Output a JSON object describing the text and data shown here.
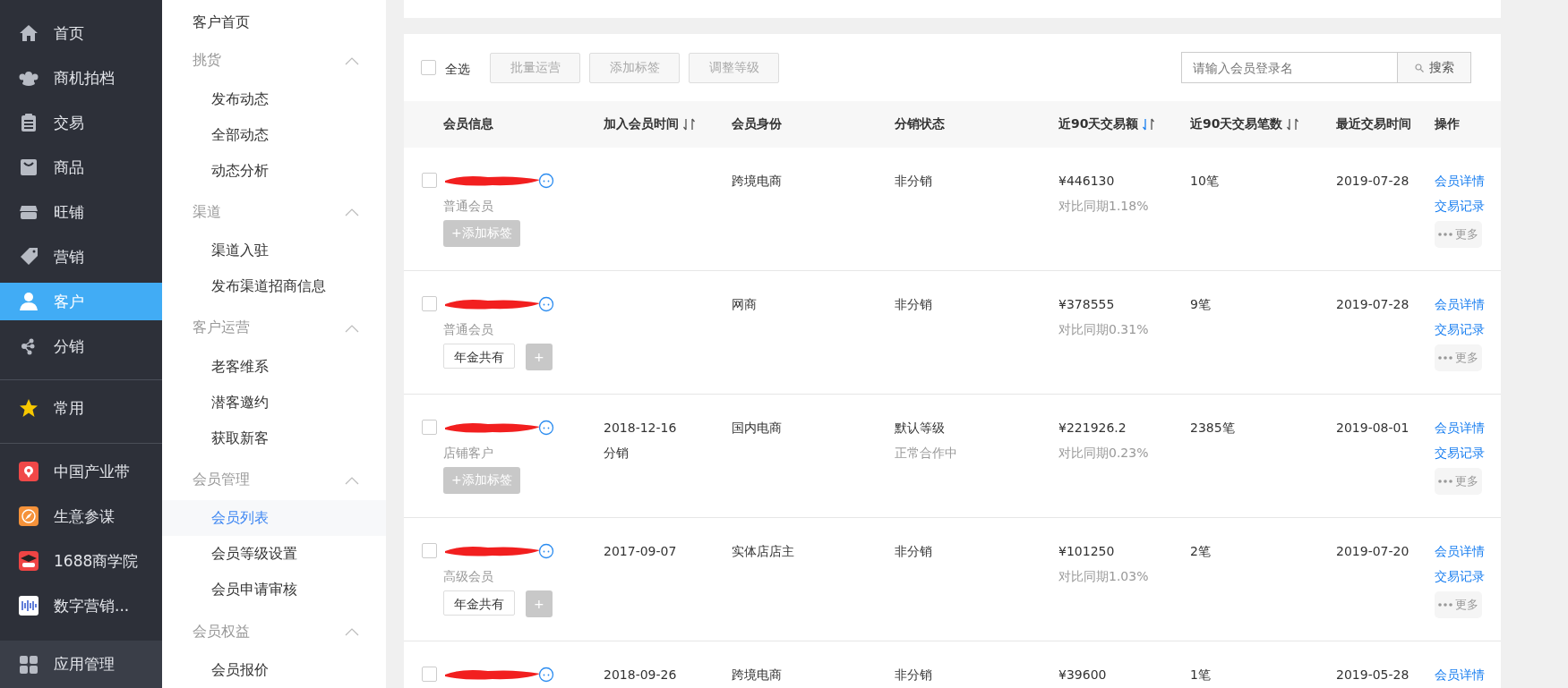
{
  "sidebar": {
    "groups": [
      [
        {
          "label": "首页",
          "selected": false
        },
        {
          "label": "商机拍档",
          "selected": false
        },
        {
          "label": "交易",
          "selected": false
        },
        {
          "label": "商品",
          "selected": false
        },
        {
          "label": "旺铺",
          "selected": false
        },
        {
          "label": "营销",
          "selected": false
        },
        {
          "label": "客户",
          "selected": true
        },
        {
          "label": "分销",
          "selected": false
        }
      ],
      [
        {
          "label": "常用",
          "selected": false
        }
      ],
      [
        {
          "label": "中国产业带",
          "selected": false
        },
        {
          "label": "生意参谋",
          "selected": false
        },
        {
          "label": "1688商学院",
          "selected": false
        },
        {
          "label": "数字营销...",
          "selected": false
        }
      ]
    ],
    "footer": {
      "label": "应用管理"
    }
  },
  "submenu": {
    "home": "客户首页",
    "sections": [
      {
        "title": "挑货",
        "expanded": true,
        "items": [
          {
            "label": "发布动态",
            "selected": false
          },
          {
            "label": "全部动态",
            "selected": false
          },
          {
            "label": "动态分析",
            "selected": false
          }
        ]
      },
      {
        "title": "渠道",
        "expanded": true,
        "items": [
          {
            "label": "渠道入驻",
            "selected": false
          },
          {
            "label": "发布渠道招商信息",
            "selected": false
          }
        ]
      },
      {
        "title": "客户运营",
        "expanded": true,
        "items": [
          {
            "label": "老客维系",
            "selected": false
          },
          {
            "label": "潜客邀约",
            "selected": false
          },
          {
            "label": "获取新客",
            "selected": false
          }
        ]
      },
      {
        "title": "会员管理",
        "expanded": true,
        "items": [
          {
            "label": "会员列表",
            "selected": true
          },
          {
            "label": "会员等级设置",
            "selected": false
          },
          {
            "label": "会员申请审核",
            "selected": false
          }
        ]
      },
      {
        "title": "会员权益",
        "expanded": true,
        "items": [
          {
            "label": "会员报价",
            "selected": false
          }
        ]
      }
    ]
  },
  "toolbar": {
    "select_all": {
      "label": "全选",
      "checked": false
    },
    "buttons": [
      {
        "label": "批量运营",
        "disabled": true
      },
      {
        "label": "添加标签",
        "disabled": true
      },
      {
        "label": "调整等级",
        "disabled": true
      }
    ],
    "search": {
      "placeholder": "请输入会员登录名",
      "button": "搜索"
    }
  },
  "table": {
    "columns": [
      {
        "label": "会员信息"
      },
      {
        "label": "加入会员时间",
        "sorted": false
      },
      {
        "label": "会员身份"
      },
      {
        "label": "分销状态"
      },
      {
        "label": "近90天交易额",
        "sorted": true
      },
      {
        "label": "近90天交易笔数",
        "sorted": false
      },
      {
        "label": "最近交易时间"
      },
      {
        "label": "操作"
      }
    ],
    "rows": [
      {
        "checked": false,
        "level": "普通会员",
        "tags": [],
        "add_tag": "+添加标签",
        "identity": "跨境电商",
        "distribution": "非分销",
        "amount": "¥446130",
        "compare": "对比同期1.18%",
        "count": "10笔",
        "last_trade": "2019-07-28",
        "actions": [
          {
            "kind": "link",
            "label": "会员详情"
          },
          {
            "kind": "link",
            "label": "交易记录"
          },
          {
            "kind": "more",
            "label": "更多"
          }
        ]
      },
      {
        "checked": false,
        "level": "普通会员",
        "tags": [
          "年金共有"
        ],
        "add_tag": "+",
        "identity": "网商",
        "distribution": "非分销",
        "amount": "¥378555",
        "compare": "对比同期0.31%",
        "count": "9笔",
        "last_trade": "2019-07-28",
        "actions": [
          {
            "kind": "link",
            "label": "会员详情"
          },
          {
            "kind": "link",
            "label": "交易记录"
          },
          {
            "kind": "more",
            "label": "更多"
          }
        ]
      },
      {
        "checked": false,
        "level": "店铺客户",
        "tags": [],
        "add_tag": "+添加标签",
        "join_date": "2018-12-16",
        "join_note": "分销",
        "identity": "国内电商",
        "distribution": "默认等级",
        "distribution_note": "正常合作中",
        "amount": "¥221926.2",
        "compare": "对比同期0.23%",
        "count": "2385笔",
        "last_trade": "2019-08-01",
        "actions": [
          {
            "kind": "link",
            "label": "会员详情"
          },
          {
            "kind": "link",
            "label": "交易记录"
          },
          {
            "kind": "more",
            "label": "更多"
          }
        ]
      },
      {
        "checked": false,
        "level": "高级会员",
        "tags": [
          "年金共有"
        ],
        "add_tag": "+",
        "join_date": "2017-09-07",
        "identity": "实体店店主",
        "distribution": "非分销",
        "amount": "¥101250",
        "compare": "对比同期1.03%",
        "count": "2笔",
        "last_trade": "2019-07-20",
        "actions": [
          {
            "kind": "link",
            "label": "会员详情"
          },
          {
            "kind": "link",
            "label": "交易记录"
          },
          {
            "kind": "more",
            "label": "更多"
          }
        ]
      },
      {
        "checked": false,
        "join_date": "2018-09-26",
        "identity": "跨境电商",
        "distribution": "非分销",
        "amount": "¥39600",
        "count": "1笔",
        "last_trade": "2019-05-28",
        "actions": [
          {
            "kind": "link",
            "label": "会员详情"
          }
        ]
      }
    ]
  }
}
